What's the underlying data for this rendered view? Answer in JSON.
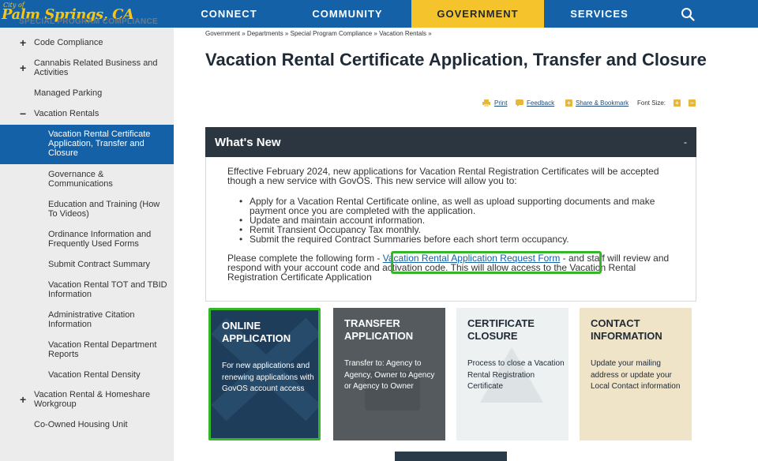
{
  "header": {
    "logo_small": "City of",
    "logo_text": "Palm Springs, CA",
    "logo_subtitle": "SPECIAL PROGRAM COMPLIANCE",
    "nav": [
      "CONNECT",
      "COMMUNITY",
      "GOVERNMENT",
      "SERVICES"
    ],
    "active_nav": "GOVERNMENT",
    "search_icon": "search-icon",
    "colors": {
      "nav_bg": "#1561a8",
      "active_bg": "#f5c32c",
      "logo": "#f5c517"
    }
  },
  "sidebar": {
    "items": [
      {
        "label": "Code Compliance",
        "toggle": "+"
      },
      {
        "label": "Cannabis Related Business and Activities",
        "toggle": "+"
      },
      {
        "label": "Managed Parking",
        "toggle": ""
      },
      {
        "label": "Vacation Rentals",
        "toggle": "−"
      },
      {
        "label": "Vacation Rental Certificate Application, Transfer and Closure",
        "toggle": "",
        "active": true
      },
      {
        "label": "Governance & Communications",
        "toggle": ""
      },
      {
        "label": "Education and Training (How To Videos)",
        "toggle": ""
      },
      {
        "label": "Ordinance Information and Frequently Used Forms",
        "toggle": ""
      },
      {
        "label": "Submit Contract Summary",
        "toggle": ""
      },
      {
        "label": "Vacation Rental TOT and TBID Information",
        "toggle": ""
      },
      {
        "label": "Administrative Citation Information",
        "toggle": ""
      },
      {
        "label": "Vacation Rental Department Reports",
        "toggle": ""
      },
      {
        "label": "Vacation Rental Density",
        "toggle": ""
      },
      {
        "label": "Vacation Rental & Homeshare Workgroup",
        "toggle": "+"
      },
      {
        "label": "Co-Owned Housing Unit",
        "toggle": ""
      }
    ]
  },
  "main": {
    "breadcrumb": "Government » Departments » Special Program Compliance » Vacation Rentals »",
    "title": "Vacation Rental Certificate Application, Transfer and Closure",
    "tools": {
      "print": "Print",
      "feedback": "Feedback",
      "share": "Share & Bookmark",
      "font_size": "Font Size:",
      "increase": "+",
      "decrease": "−"
    },
    "whats_new": {
      "title": "What's New",
      "collapse": "-",
      "intro": "Effective February 2024, new applications for Vacation Rental Registration Certificates will be accepted though a new service with GovOS. This new service will allow you to:",
      "bullets": [
        "Apply for a Vacation Rental Certificate online, as well as upload supporting documents and make payment once you are completed with the application.",
        "Update and maintain account information.",
        "Remit Transient Occupancy Tax monthly.",
        "Submit the required Contract Summaries before each short term occupancy."
      ],
      "p2_before": "Please complete the following form - ",
      "p2_link": "Vacation Rental Application Request Form",
      "p2_after": " - and staff will review and respond with your account code and activation code. This will allow access to the Vacation Rental Registration Certificate Application"
    },
    "cards": [
      {
        "title": "ONLINE APPLICATION",
        "desc": "For new applications and renewing applications with GovOS account access"
      },
      {
        "title": "TRANSFER APPLICATION",
        "desc": "Transfer to: Agency to Agency, Owner to Agency or Agency to Owner"
      },
      {
        "title": "CERTIFICATE CLOSURE",
        "desc": "Process to close a Vacation Rental Registration Certificate"
      },
      {
        "title": "CONTACT INFORMATION",
        "desc": "Update your mailing address or update your Local Contact information"
      }
    ]
  }
}
